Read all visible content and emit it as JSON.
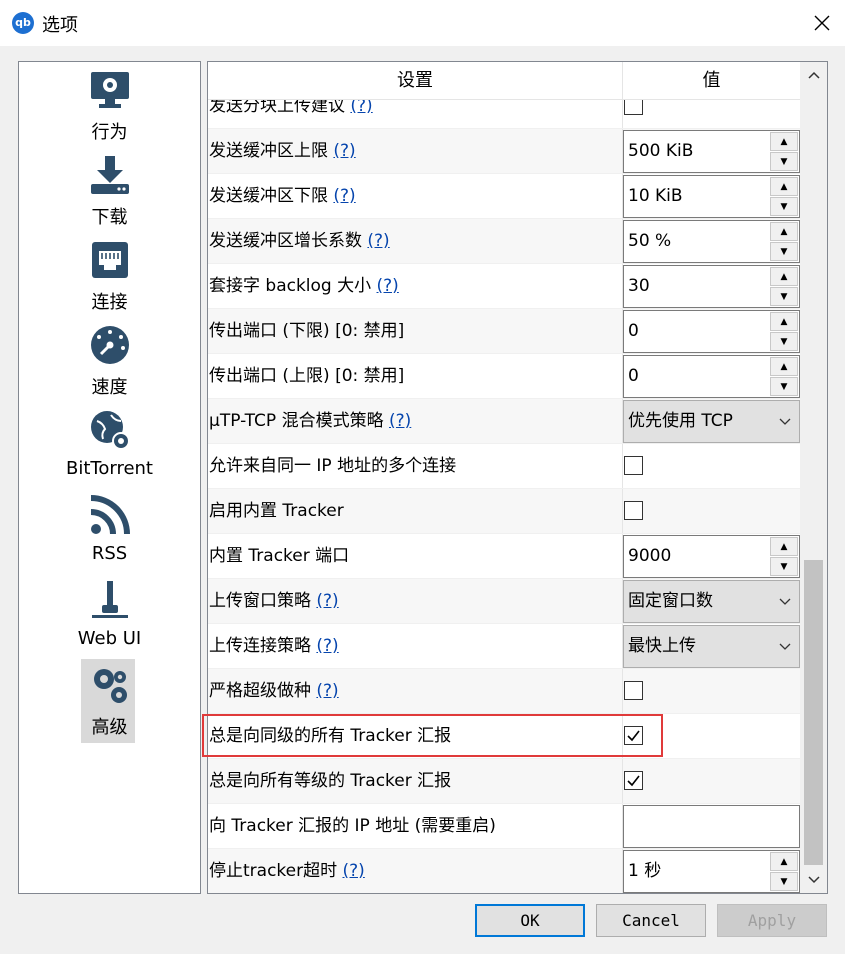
{
  "window": {
    "title": "选项",
    "app_icon_text": "qb"
  },
  "sidebar": {
    "items": [
      {
        "label": "行为",
        "icon": "monitor-gear-icon"
      },
      {
        "label": "下载",
        "icon": "download-icon"
      },
      {
        "label": "连接",
        "icon": "ethernet-port-icon"
      },
      {
        "label": "速度",
        "icon": "speedometer-icon"
      },
      {
        "label": "BitTorrent",
        "icon": "globe-gear-icon"
      },
      {
        "label": "RSS",
        "icon": "rss-icon"
      },
      {
        "label": "Web UI",
        "icon": "web-ui-plug-icon"
      },
      {
        "label": "高级",
        "icon": "gears-icon",
        "selected": true
      }
    ]
  },
  "table": {
    "headers": {
      "setting": "设置",
      "value": "值"
    },
    "help_text": "(?)",
    "rows": [
      {
        "name": "发送分块上传建议",
        "help": true,
        "type": "checkbox",
        "checked": false
      },
      {
        "name": "发送缓冲区上限",
        "help": true,
        "type": "spin",
        "value": "500 KiB"
      },
      {
        "name": "发送缓冲区下限",
        "help": true,
        "type": "spin",
        "value": "10 KiB"
      },
      {
        "name": "发送缓冲区增长系数",
        "help": true,
        "type": "spin",
        "value": "50 %"
      },
      {
        "name": "套接字 backlog 大小",
        "help": true,
        "type": "spin",
        "value": "30"
      },
      {
        "name": "传出端口 (下限) [0: 禁用]",
        "help": false,
        "type": "spin",
        "value": "0"
      },
      {
        "name": "传出端口 (上限) [0: 禁用]",
        "help": false,
        "type": "spin",
        "value": "0"
      },
      {
        "name": "µTP-TCP 混合模式策略",
        "help": true,
        "type": "combo",
        "value": "优先使用 TCP"
      },
      {
        "name": "允许来自同一 IP 地址的多个连接",
        "help": false,
        "type": "checkbox",
        "checked": false
      },
      {
        "name": "启用内置 Tracker",
        "help": false,
        "type": "checkbox",
        "checked": false
      },
      {
        "name": "内置 Tracker 端口",
        "help": false,
        "type": "spin",
        "value": "9000"
      },
      {
        "name": "上传窗口策略",
        "help": true,
        "type": "combo",
        "value": "固定窗口数"
      },
      {
        "name": "上传连接策略",
        "help": true,
        "type": "combo",
        "value": "最快上传"
      },
      {
        "name": "严格超级做种",
        "help": true,
        "type": "checkbox",
        "checked": false
      },
      {
        "name": "总是向同级的所有 Tracker 汇报",
        "help": false,
        "type": "checkbox",
        "checked": true,
        "highlighted": true
      },
      {
        "name": "总是向所有等级的 Tracker 汇报",
        "help": false,
        "type": "checkbox",
        "checked": true
      },
      {
        "name": "向 Tracker 汇报的 IP 地址 (需要重启)",
        "help": false,
        "type": "text",
        "value": ""
      },
      {
        "name": "停止tracker超时",
        "help": true,
        "type": "spin",
        "value": "1 秒"
      }
    ]
  },
  "buttons": {
    "ok": "OK",
    "cancel": "Cancel",
    "apply": "Apply"
  },
  "colors": {
    "highlight_border": "#e03a3a",
    "link": "#0645ad",
    "ok_border": "#0078d7"
  }
}
